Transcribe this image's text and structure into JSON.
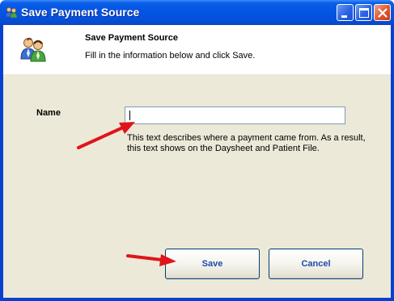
{
  "window": {
    "title": "Save Payment Source",
    "icon": "users-icon"
  },
  "header": {
    "title": "Save Payment Source",
    "subtitle": "Fill in the information below and click Save.",
    "icon": "users-icon"
  },
  "form": {
    "name_label": "Name",
    "name_value": "",
    "help_text": "This text describes where a payment came from. As a result, this text shows on the Daysheet and Patient File."
  },
  "buttons": {
    "save_label": "Save",
    "cancel_label": "Cancel"
  },
  "annotations": {
    "arrow_color": "#e0141b"
  },
  "colors": {
    "titlebar": "#0554e3",
    "client_bg": "#ece9d8",
    "button_text": "#1f4aa7"
  }
}
